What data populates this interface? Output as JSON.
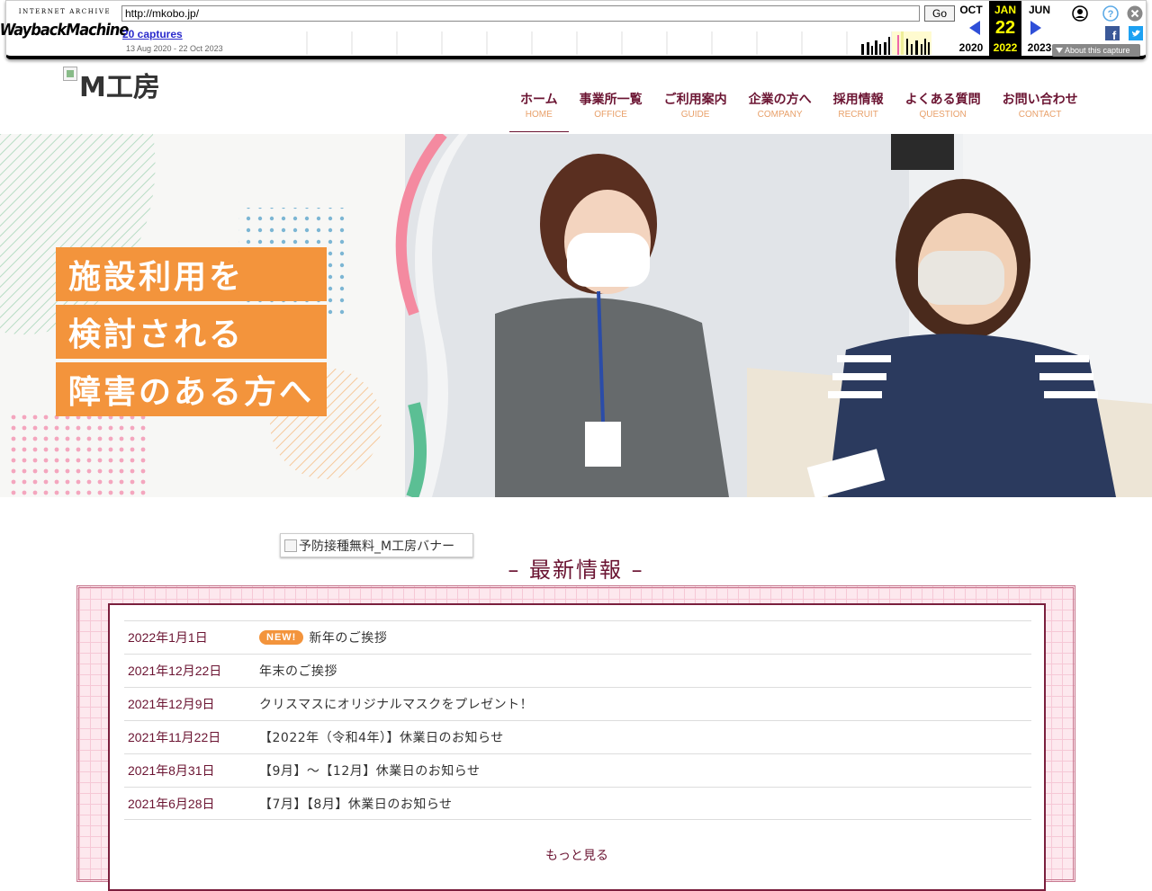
{
  "wayback": {
    "logo_top": "INTERNET ARCHIVE",
    "logo_main": "WaybackMachine",
    "url": "http://mkobo.jp/",
    "go_label": "Go",
    "captures": "20 captures",
    "range": "13 Aug 2020 - 22 Oct 2023",
    "prev_month": "OCT",
    "prev_year": "2020",
    "cur_month": "JAN",
    "cur_day": "22",
    "cur_year": "2022",
    "next_month": "JUN",
    "next_year": "2023",
    "about": "About this capture",
    "colors": {
      "current_bg": "#000000",
      "current_fg": "#ffff00",
      "arrow": "#2f4fd8"
    }
  },
  "site": {
    "logo_alt": "M工房",
    "nav": [
      {
        "jp": "ホーム",
        "en": "HOME"
      },
      {
        "jp": "事業所一覧",
        "en": "OFFICE"
      },
      {
        "jp": "ご利用案内",
        "en": "GUIDE"
      },
      {
        "jp": "企業の方へ",
        "en": "COMPANY"
      },
      {
        "jp": "採用情報",
        "en": "RECRUIT"
      },
      {
        "jp": "よくある質問",
        "en": "QUESTION"
      },
      {
        "jp": "お問い合わせ",
        "en": "CONTACT"
      }
    ],
    "active_nav": "HOME",
    "colors": {
      "brand": "#6b1432",
      "accent": "#f3943c",
      "subtext": "#e8a06a"
    }
  },
  "hero": {
    "lines": [
      "施設利用を",
      "検討される",
      "障害のある方へ"
    ]
  },
  "banner_alt": "予防接種無料_M工房バナー",
  "news": {
    "title": "– 最新情報 –",
    "badge": "NEW!",
    "items": [
      {
        "date": "2022年1月1日",
        "text": "新年のご挨拶",
        "is_new": true
      },
      {
        "date": "2021年12月22日",
        "text": "年末のご挨拶",
        "is_new": false
      },
      {
        "date": "2021年12月9日",
        "text": "クリスマスにオリジナルマスクをプレゼント！",
        "is_new": false
      },
      {
        "date": "2021年11月22日",
        "text": "【2022年（令和4年）】休業日のお知らせ",
        "is_new": false
      },
      {
        "date": "2021年8月31日",
        "text": "【9月】〜【12月】休業日のお知らせ",
        "is_new": false
      },
      {
        "date": "2021年6月28日",
        "text": "【7月】【8月】休業日のお知らせ",
        "is_new": false
      }
    ],
    "more": "もっと見る "
  }
}
